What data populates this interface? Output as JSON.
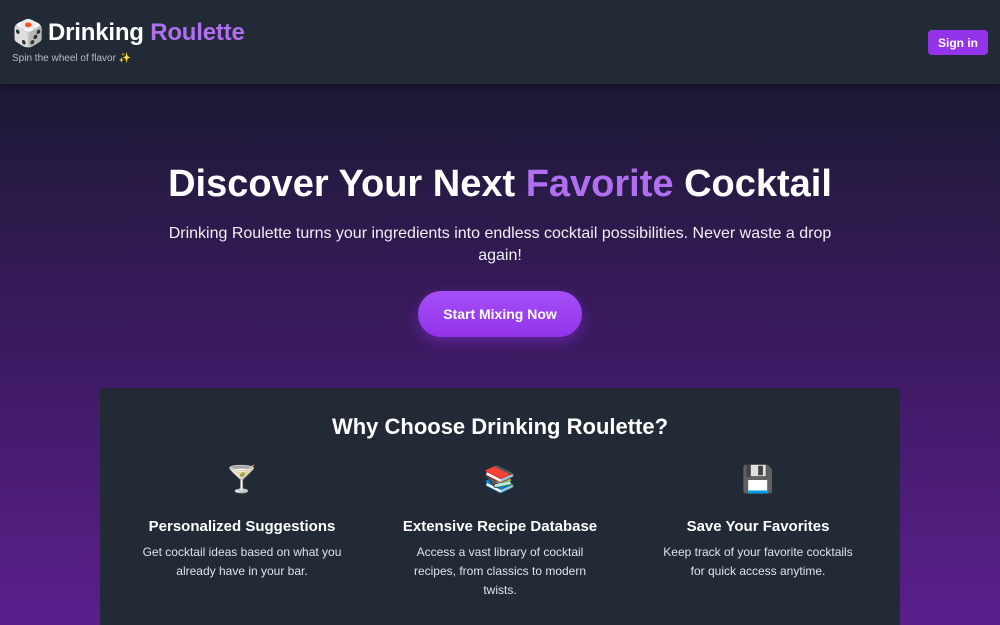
{
  "header": {
    "brand_icon": "dice-icon",
    "brand_title_main": "Drinking ",
    "brand_title_accent": "Roulette",
    "tagline": "Spin the wheel of flavor ✨",
    "signin_label": "Sign in"
  },
  "hero": {
    "title_before": "Discover Your Next ",
    "title_accent": "Favorite",
    "title_after": " Cocktail",
    "subtitle": "Drinking Roulette turns your ingredients into endless cocktail possibilities. Never waste a drop again!",
    "cta_label": "Start Mixing Now"
  },
  "features": {
    "title": "Why Choose Drinking Roulette?",
    "items": [
      {
        "icon": "cocktail-glass-icon",
        "glyph": "🍸",
        "title": "Personalized Suggestions",
        "desc": "Get cocktail ideas based on what you already have in your bar."
      },
      {
        "icon": "books-icon",
        "glyph": "📚",
        "title": "Extensive Recipe Database",
        "desc": "Access a vast library of cocktail recipes, from classics to modern twists."
      },
      {
        "icon": "floppy-disk-icon",
        "glyph": "💾",
        "title": "Save Your Favorites",
        "desc": "Keep track of your favorite cocktails for quick access anytime."
      }
    ]
  },
  "colors": {
    "accent": "#9333ea",
    "accent_text": "#b06ef0",
    "panel": "#222a35"
  }
}
